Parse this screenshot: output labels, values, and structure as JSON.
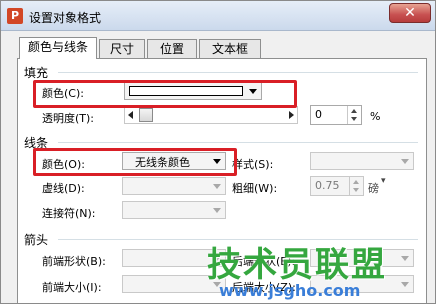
{
  "window": {
    "title": "设置对象格式",
    "app_icon_glyph": "P",
    "close_glyph": "✕"
  },
  "tabs": [
    {
      "label": "颜色与线条",
      "active": true
    },
    {
      "label": "尺寸",
      "active": false
    },
    {
      "label": "位置",
      "active": false
    },
    {
      "label": "文本框",
      "active": false
    }
  ],
  "fill": {
    "section_label": "填充",
    "color_label": "颜色(C):",
    "color_value": "#ffffff",
    "transparency_label": "透明度(T):",
    "transparency_value": "0",
    "transparency_unit": "%"
  },
  "line": {
    "section_label": "线条",
    "color_label": "颜色(O):",
    "color_value": "无线条颜色",
    "style_label": "样式(S):",
    "dash_label": "虚线(D):",
    "weight_label": "粗细(W):",
    "weight_value": "0.75",
    "weight_unit": "磅",
    "connector_label": "连接符(N):"
  },
  "arrows": {
    "section_label": "箭头",
    "begin_style_label": "前端形状(B):",
    "begin_size_label": "前端大小(I):",
    "end_style_label": "后端形状(E):",
    "end_size_label": "后端大小(Z):"
  },
  "watermark": {
    "text": "技术员联盟",
    "url": "www.jsgho.com"
  },
  "colors": {
    "highlight": "#d91f26",
    "watermark_green": "#35a73f",
    "watermark_blue": "#3a7ed8"
  }
}
